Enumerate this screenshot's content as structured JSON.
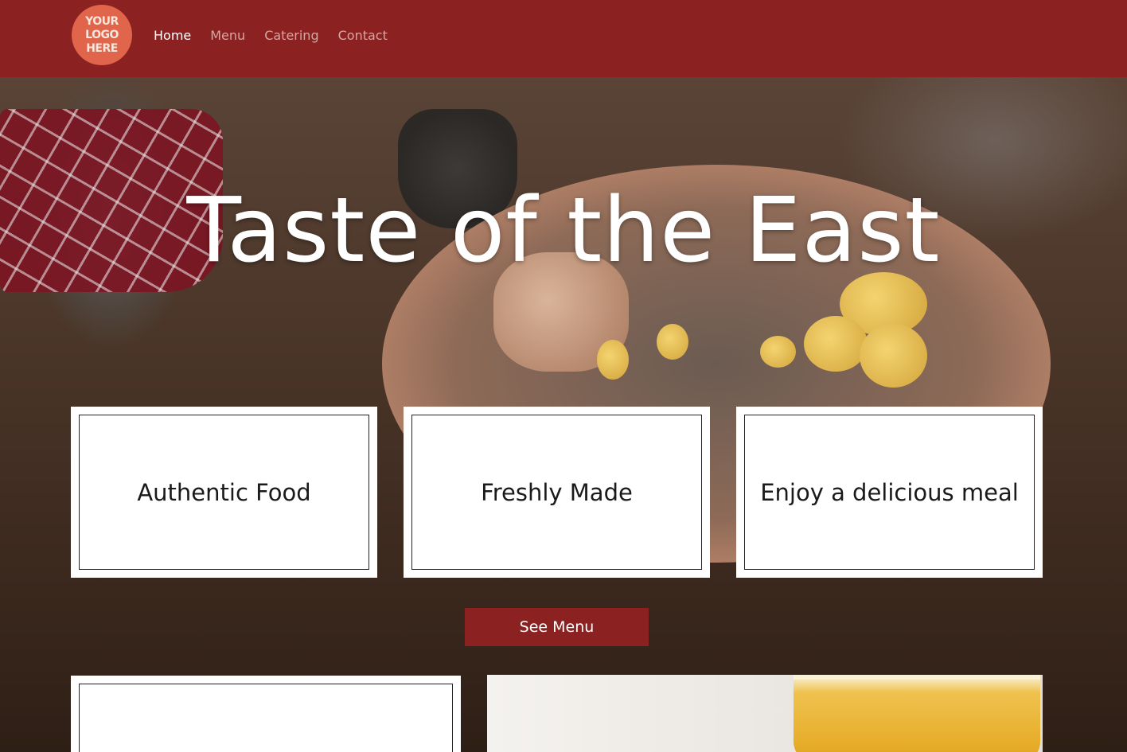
{
  "header": {
    "logo_lines": [
      "YOUR",
      "LOGO",
      "HERE"
    ],
    "nav": [
      {
        "label": "Home",
        "active": true
      },
      {
        "label": "Menu",
        "active": false
      },
      {
        "label": "Catering",
        "active": false
      },
      {
        "label": "Contact",
        "active": false
      }
    ]
  },
  "hero": {
    "title": "Taste of the East",
    "features": [
      "Authentic Food",
      "Freshly Made",
      "Enjoy a delicious meal"
    ],
    "cta_label": "See Menu"
  },
  "colors": {
    "brand": "#8b2121",
    "logo": "#e0654a",
    "nav_inactive": "#d4a7a2",
    "nav_active": "#ffffff"
  }
}
